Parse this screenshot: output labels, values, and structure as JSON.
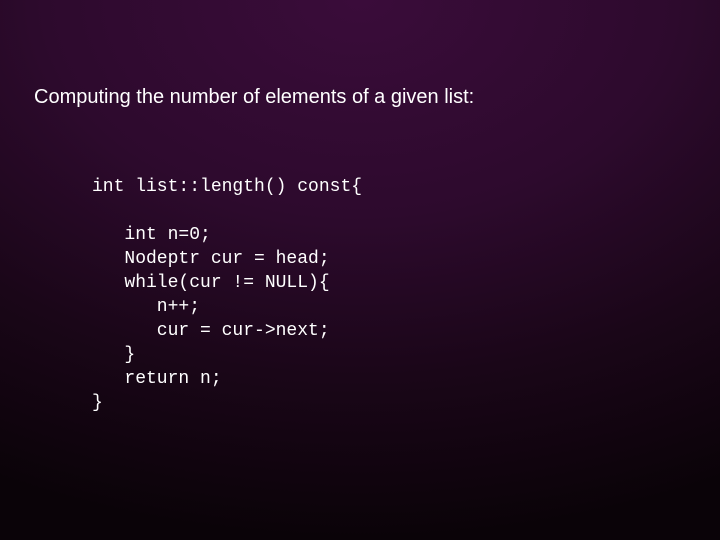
{
  "slide": {
    "title": "Computing the number of elements of a given list:",
    "code": {
      "l1": "int list::length() const{",
      "l2": "",
      "l3": "   int n=0;",
      "l4": "   Nodeptr cur = head;",
      "l5": "   while(cur != NULL){",
      "l6": "      n++;",
      "l7": "      cur = cur->next;",
      "l8": "   }",
      "l9": "   return n;",
      "l10": "}"
    }
  }
}
